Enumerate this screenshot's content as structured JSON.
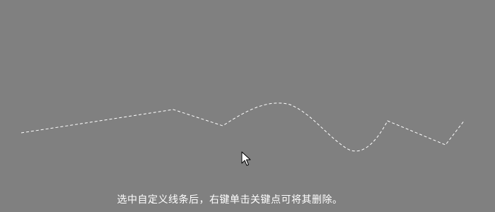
{
  "canvas": {
    "background_color": "#808080",
    "line_color": "#ffffff",
    "line_style": "dashed"
  },
  "cursor": {
    "icon": "arrow-cursor-icon"
  },
  "hint": {
    "text": "选中自定义线条后，右键单击关键点可将其删除。"
  }
}
